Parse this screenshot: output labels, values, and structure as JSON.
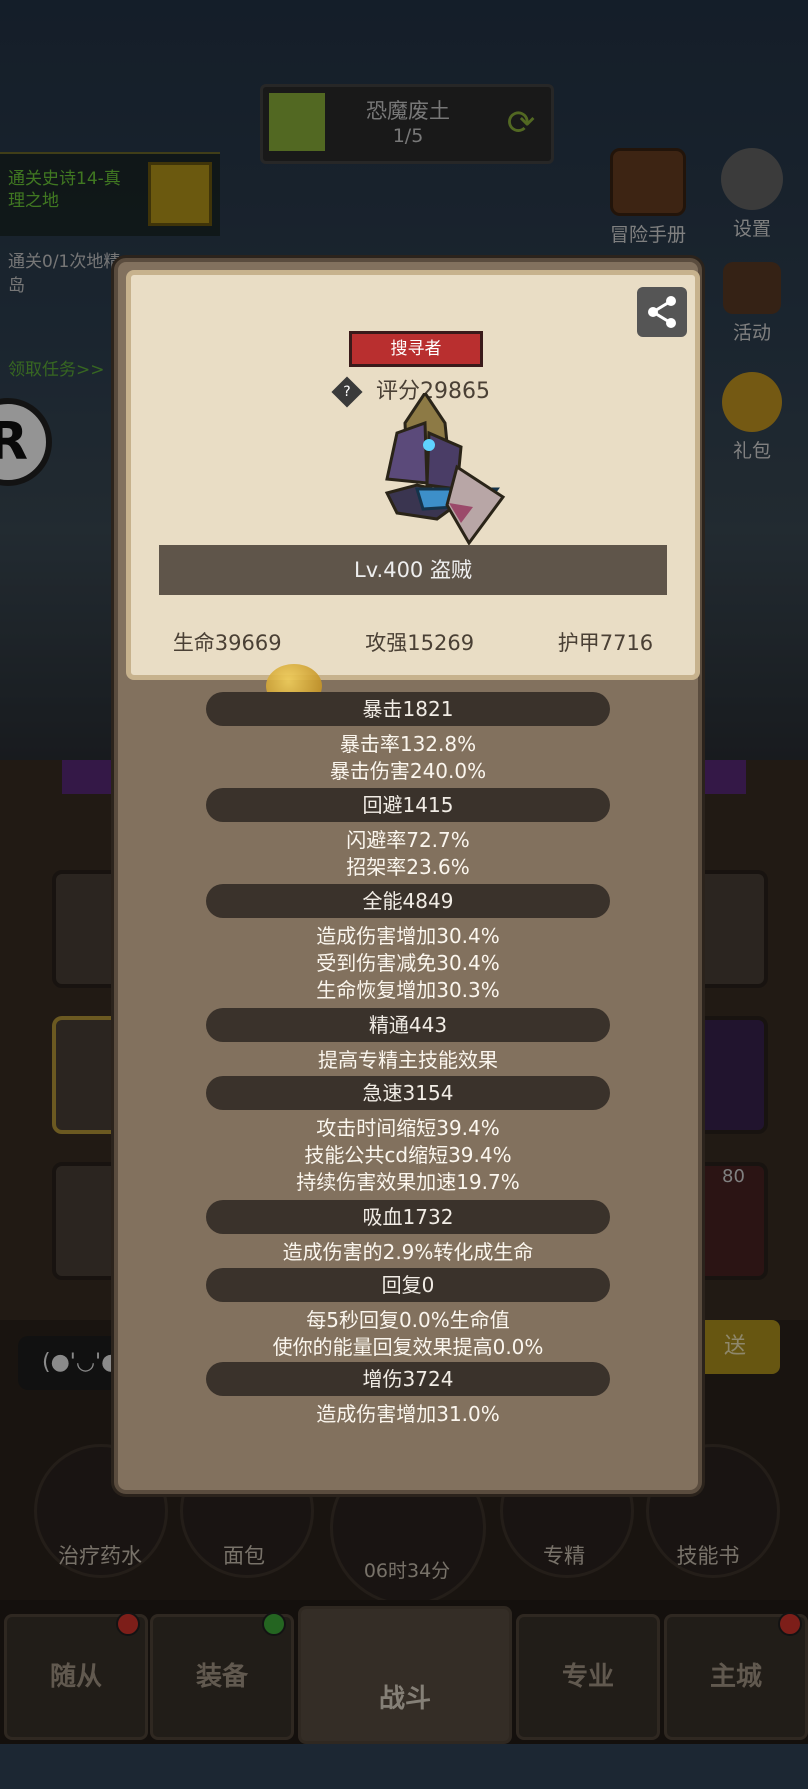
{
  "stage": {
    "name": "恐魔废土",
    "progress": "1/5"
  },
  "quests": {
    "q1_text": "通关史诗14-真理之地",
    "q2_text": "通关0/1次地精岛",
    "q3_text": "领取任务>>"
  },
  "right_buttons": {
    "manual": "冒险手册",
    "settings": "设置",
    "activity": "活动",
    "gift": "礼包"
  },
  "lower": {
    "timer": "06时34分",
    "count_badge": "80",
    "left_face_text": "(●'◡'●",
    "send_text": "送",
    "items": [
      "治疗药水",
      "面包",
      "专精",
      "技能书"
    ]
  },
  "nav": {
    "tabs": [
      "随从",
      "装备",
      "战斗",
      "专业",
      "主城"
    ]
  },
  "colors": {
    "badge_red": "#b92f2f",
    "notify_red": "#d8352b",
    "notify_green": "#3fae3a"
  },
  "popup": {
    "class_name": "搜寻者",
    "score": "评分29865",
    "score_help_icon": "question-diamond-icon",
    "level_line": "Lv.400 盗贼",
    "hp": "生命39669",
    "ap": "攻强15269",
    "armor": "护甲7716",
    "sections": [
      {
        "header": "暴击1821",
        "lines": [
          "暴击率132.8%",
          "暴击伤害240.0%"
        ]
      },
      {
        "header": "回避1415",
        "lines": [
          "闪避率72.7%",
          "招架率23.6%"
        ]
      },
      {
        "header": "全能4849",
        "lines": [
          "造成伤害增加30.4%",
          "受到伤害减免30.4%",
          "生命恢复增加30.3%"
        ]
      },
      {
        "header": "精通443",
        "lines": [
          "提高专精主技能效果"
        ]
      },
      {
        "header": "急速3154",
        "lines": [
          "攻击时间缩短39.4%",
          "技能公共cd缩短39.4%",
          "持续伤害效果加速19.7%"
        ]
      },
      {
        "header": "吸血1732",
        "lines": [
          "造成伤害的2.9%转化成生命"
        ]
      },
      {
        "header": "回复0",
        "lines": [
          "每5秒回复0.0%生命值",
          "使你的能量回复效果提高0.0%"
        ]
      },
      {
        "header": "增伤3724",
        "lines": [
          "造成伤害增加31.0%"
        ]
      }
    ]
  }
}
